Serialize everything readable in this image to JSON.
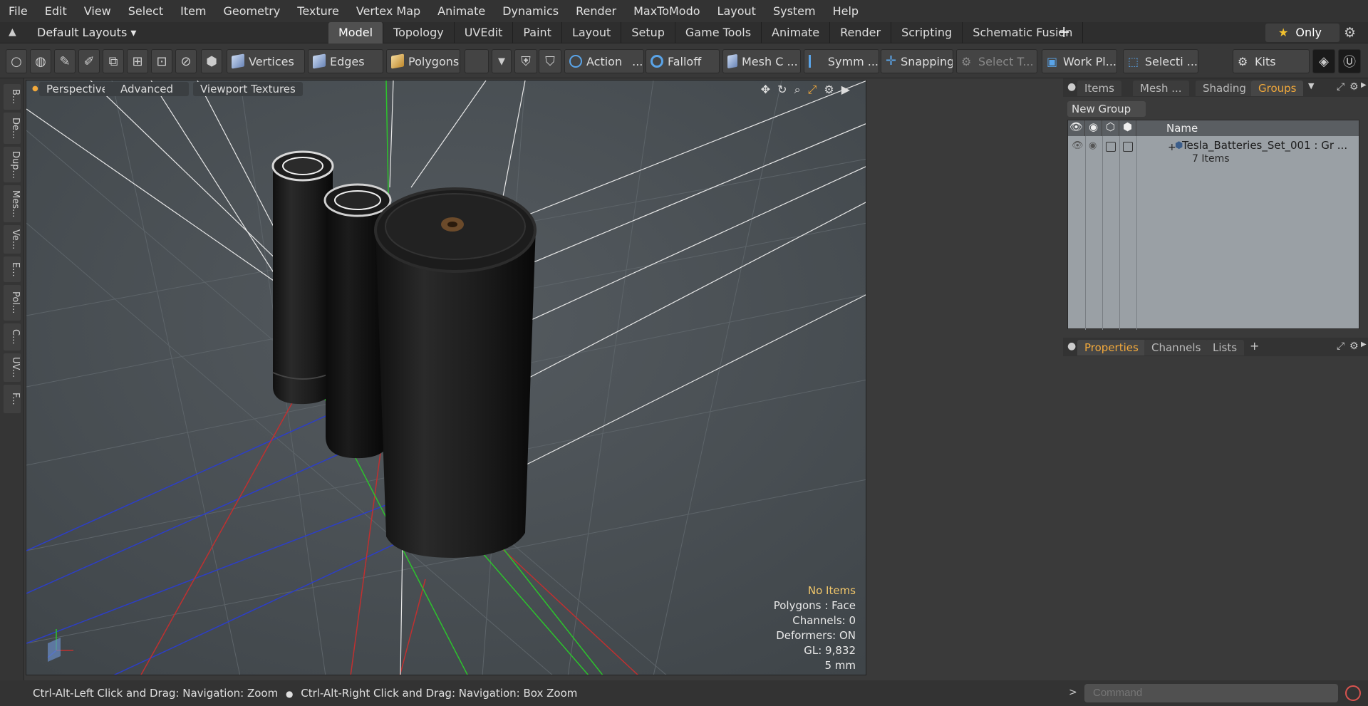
{
  "menubar": {
    "items": [
      "File",
      "Edit",
      "View",
      "Select",
      "Item",
      "Geometry",
      "Texture",
      "Vertex Map",
      "Animate",
      "Dynamics",
      "Render",
      "MaxToModo",
      "Layout",
      "System",
      "Help"
    ]
  },
  "layoutbar": {
    "layout_name": "Default Layouts ▾",
    "tabs": [
      "Model",
      "Topology",
      "UVEdit",
      "Paint",
      "Layout",
      "Setup",
      "Game Tools",
      "Animate",
      "Render",
      "Scripting",
      "Schematic Fusion"
    ],
    "active_tab": "Model",
    "only_label": "Only"
  },
  "toolbar": {
    "vertices": "Vertices",
    "edges": "Edges",
    "polygons": "Polygons",
    "action": "Action",
    "action_more": "...",
    "falloff": "Falloff",
    "mesh_c": "Mesh C ...",
    "symm": "Symm ...",
    "snapping": "Snapping",
    "select_t": "Select T...",
    "work_pl": "Work Pl...",
    "selecti": "Selecti ...",
    "kits": "Kits"
  },
  "leftbar": {
    "tabs": [
      "B...",
      "De...",
      "Dup...",
      "Mes...",
      "Ve...",
      "E...",
      "Pol...",
      "C...",
      "UV...",
      "F..."
    ]
  },
  "viewport": {
    "perspective": "Perspective",
    "advanced": "Advanced",
    "viewport_textures": "Viewport Textures",
    "stats": {
      "no_items": "No Items",
      "polygons": "Polygons : Face",
      "channels": "Channels: 0",
      "deformers": "Deformers: ON",
      "gl": "GL: 9,832",
      "unit": "5 mm"
    }
  },
  "statusbar": {
    "hint_left": "Ctrl-Alt-Left Click and Drag: Navigation: Zoom",
    "hint_right": "Ctrl-Alt-Right Click and Drag: Navigation: Box Zoom"
  },
  "command": {
    "placeholder": "Command"
  },
  "right_top": {
    "tabs": [
      "Items",
      "Mesh ...",
      "Shading",
      "Groups"
    ],
    "active_tab": "Groups",
    "new_group": "New Group",
    "col_name": "Name",
    "group_name": "Tesla_Batteries_Set_001 : Gr ...",
    "group_count": "7 Items"
  },
  "right_bottom": {
    "tabs": [
      "Properties",
      "Channels",
      "Lists"
    ],
    "active_tab": "Properties"
  },
  "colors": {
    "accent": "#f2a93b",
    "viewport_bg": "#4a5055",
    "axis_x": "#c83232",
    "axis_y": "#32c832",
    "axis_z": "#3232c8"
  }
}
